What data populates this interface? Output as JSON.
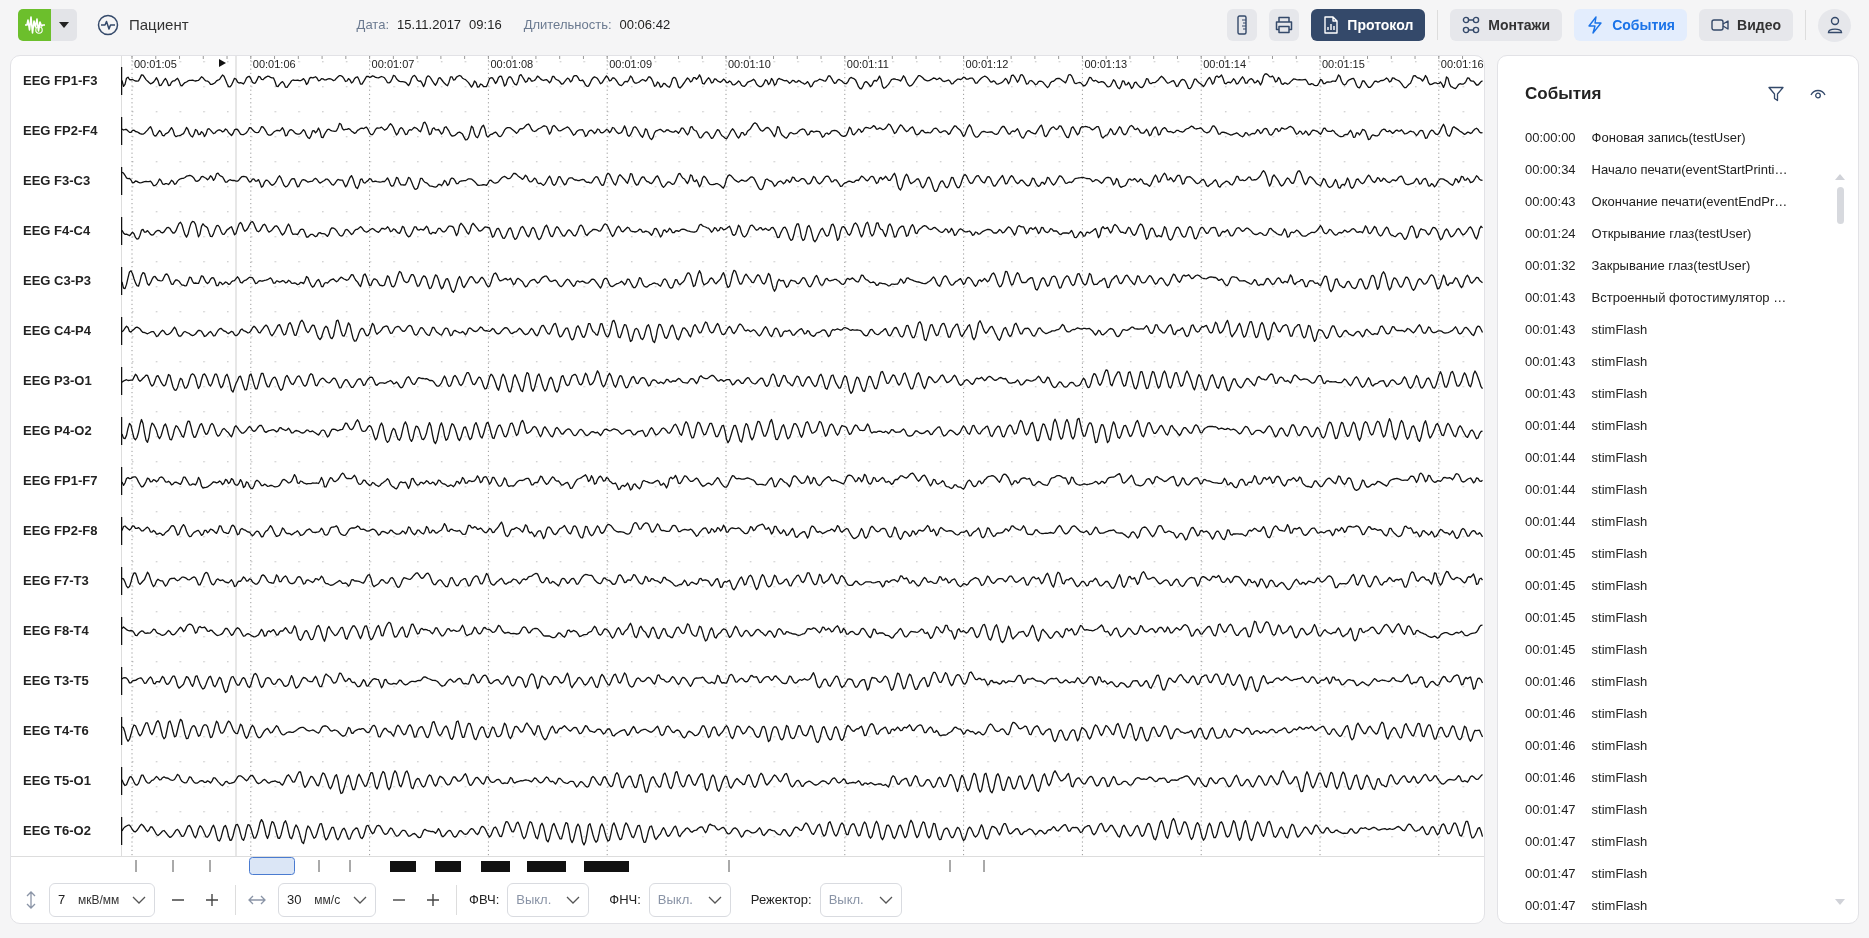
{
  "header": {
    "patient_link": "Пациент",
    "date_label": "Дата:",
    "date": "15.11.2017",
    "time": "09:16",
    "duration_label": "Длительность:",
    "duration": "00:06:42"
  },
  "toolbar": {
    "protocol": "Протокол",
    "toggles": [
      {
        "label": "Монтажи",
        "selected": false
      },
      {
        "label": "События",
        "selected": true
      },
      {
        "label": "Видео",
        "selected": false
      }
    ]
  },
  "eeg": {
    "time_labels": [
      "00:01:05",
      "00:01:06",
      "00:01:07",
      "00:01:08",
      "00:01:09",
      "00:01:10",
      "00:01:11",
      "00:01:12",
      "00:01:13",
      "00:01:14",
      "00:01:15",
      "00:01:16"
    ],
    "channels": [
      "EEG FP1-F3",
      "EEG FP2-F4",
      "EEG F3-C3",
      "EEG F4-C4",
      "EEG C3-P3",
      "EEG C4-P4",
      "EEG P3-O1",
      "EEG P4-O2",
      "EEG FP1-F7",
      "EEG FP2-F8",
      "EEG F7-T3",
      "EEG F8-T4",
      "EEG T3-T5",
      "EEG T4-T6",
      "EEG T5-O1",
      "EEG T6-O2"
    ]
  },
  "controls": {
    "sensitivity": {
      "value": "7",
      "unit": "мкВ/мм"
    },
    "speed": {
      "value": "30",
      "unit": "мм/с"
    },
    "filters": [
      {
        "label": "ФВЧ:",
        "placeholder": "Выкл."
      },
      {
        "label": "ФНЧ:",
        "placeholder": "Выкл."
      },
      {
        "label": "Режектор:",
        "placeholder": "Выкл."
      }
    ]
  },
  "events": {
    "title": "События",
    "items": [
      {
        "time": "00:00:00",
        "text": "Фоновая запись(testUser)"
      },
      {
        "time": "00:00:34",
        "text": "Начало печати(eventStartPrinti…"
      },
      {
        "time": "00:00:43",
        "text": "Окончание печати(eventEndPr…"
      },
      {
        "time": "00:01:24",
        "text": "Открывание глаз(testUser)"
      },
      {
        "time": "00:01:32",
        "text": "Закрывание глаз(testUser)"
      },
      {
        "time": "00:01:43",
        "text": "Встроенный фотостимулятор …"
      },
      {
        "time": "00:01:43",
        "text": "stimFlash"
      },
      {
        "time": "00:01:43",
        "text": "stimFlash"
      },
      {
        "time": "00:01:43",
        "text": "stimFlash"
      },
      {
        "time": "00:01:44",
        "text": "stimFlash"
      },
      {
        "time": "00:01:44",
        "text": "stimFlash"
      },
      {
        "time": "00:01:44",
        "text": "stimFlash"
      },
      {
        "time": "00:01:44",
        "text": "stimFlash"
      },
      {
        "time": "00:01:45",
        "text": "stimFlash"
      },
      {
        "time": "00:01:45",
        "text": "stimFlash"
      },
      {
        "time": "00:01:45",
        "text": "stimFlash"
      },
      {
        "time": "00:01:45",
        "text": "stimFlash"
      },
      {
        "time": "00:01:46",
        "text": "stimFlash"
      },
      {
        "time": "00:01:46",
        "text": "stimFlash"
      },
      {
        "time": "00:01:46",
        "text": "stimFlash"
      },
      {
        "time": "00:01:46",
        "text": "stimFlash"
      },
      {
        "time": "00:01:47",
        "text": "stimFlash"
      },
      {
        "time": "00:01:47",
        "text": "stimFlash"
      },
      {
        "time": "00:01:47",
        "text": "stimFlash"
      },
      {
        "time": "00:01:47",
        "text": "stimFlash"
      }
    ]
  }
}
